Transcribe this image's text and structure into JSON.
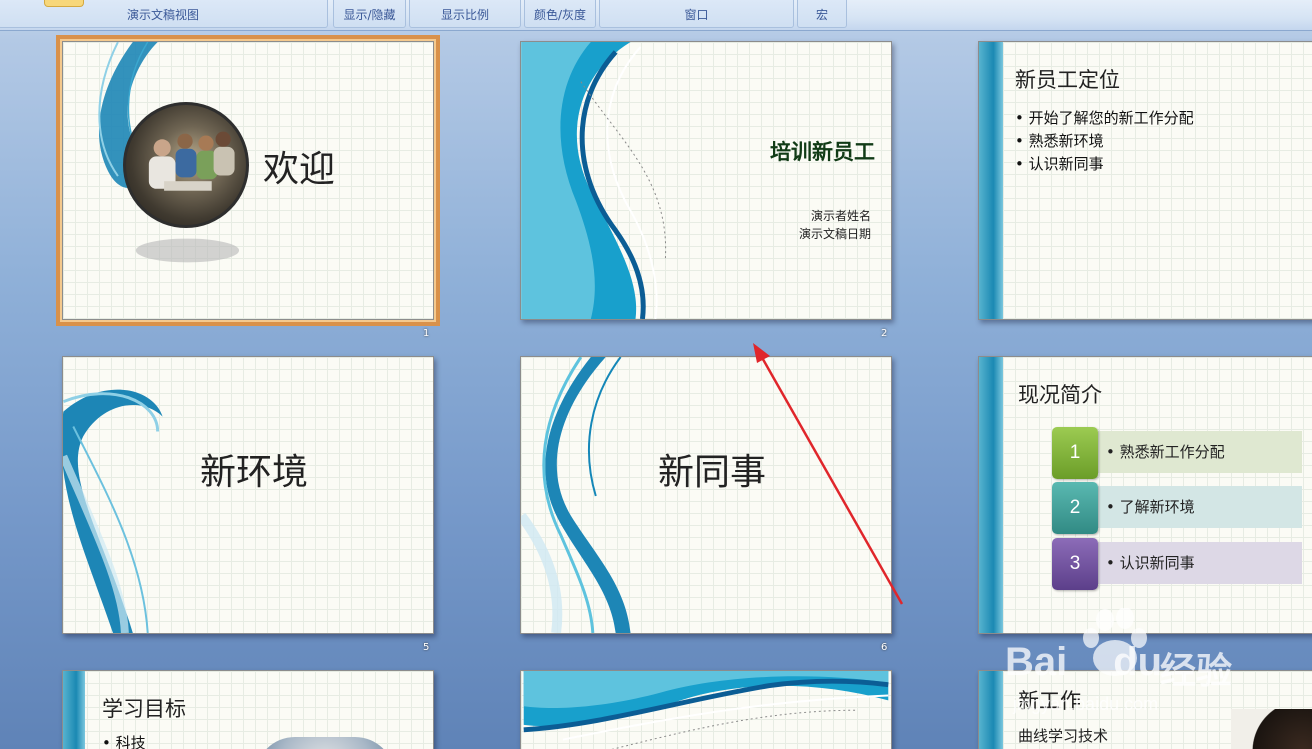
{
  "ribbon": {
    "groups": [
      "演示文稿视图",
      "显示/隐藏",
      "显示比例",
      "颜色/灰度",
      "窗口",
      "宏"
    ]
  },
  "slides": [
    {
      "number": "1",
      "title": "欢迎",
      "selected": true
    },
    {
      "number": "2",
      "title": "培训新员工",
      "lines": [
        "演示者姓名",
        "演示文稿日期"
      ]
    },
    {
      "number": "",
      "title": "新员工定位",
      "bullets": [
        "开始了解您的新工作分配",
        "熟悉新环境",
        "认识新同事"
      ]
    },
    {
      "number": "5",
      "title": "新环境"
    },
    {
      "number": "6",
      "title": "新同事"
    },
    {
      "number": "",
      "title": "现况简介",
      "items": [
        {
          "num": "1",
          "text": "熟悉新工作分配",
          "color": "#7cab31"
        },
        {
          "num": "2",
          "text": "了解新环境",
          "color": "#3d9e98"
        },
        {
          "num": "3",
          "text": "认识新同事",
          "color": "#6b4f9a"
        }
      ]
    },
    {
      "number": "",
      "title": "学习目标",
      "bullets": [
        "科技"
      ]
    },
    {
      "number": "",
      "title": ""
    },
    {
      "number": "",
      "title": "新工作",
      "subtitle": "曲线学习技术"
    }
  ],
  "watermark": {
    "brand": "Bai",
    "brand2": "du",
    "label": "经验",
    "url": "jingyan.baidu.com"
  },
  "colors": {
    "accent_blue": "#1a8fc0",
    "selection": "#d9914a",
    "arrow": "#e0262b"
  }
}
